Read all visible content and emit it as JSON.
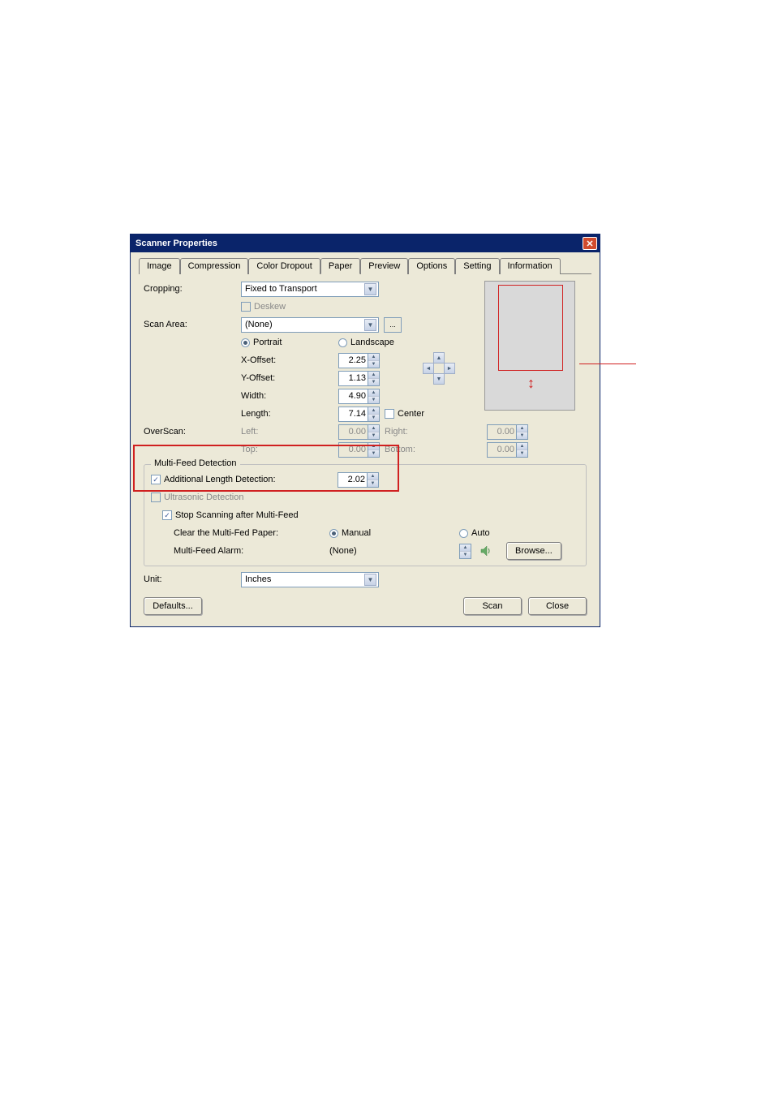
{
  "window": {
    "title": "Scanner Properties"
  },
  "tabs": {
    "image": "Image",
    "compression": "Compression",
    "color_dropout": "Color Dropout",
    "paper": "Paper",
    "preview": "Preview",
    "options": "Options",
    "setting": "Setting",
    "information": "Information"
  },
  "labels": {
    "cropping": "Cropping:",
    "deskew": "Deskew",
    "scan_area": "Scan Area:",
    "portrait": "Portrait",
    "landscape": "Landscape",
    "x_offset": "X-Offset:",
    "y_offset": "Y-Offset:",
    "width": "Width:",
    "length": "Length:",
    "center": "Center",
    "overscan": "OverScan:",
    "left": "Left:",
    "right": "Right:",
    "top": "Top:",
    "bottom": "Bottom:",
    "multi_feed_detection": "Multi-Feed Detection",
    "additional_length": "Additional Length Detection:",
    "ultrasonic": "Ultrasonic Detection",
    "stop_scanning": "Stop Scanning after Multi-Feed",
    "clear_multifed": "Clear the Multi-Fed Paper:",
    "manual": "Manual",
    "auto": "Auto",
    "multifeed_alarm": "Multi-Feed Alarm:",
    "unit": "Unit:"
  },
  "values": {
    "cropping": "Fixed to Transport",
    "scan_area": "(None)",
    "x_offset": "2.25",
    "y_offset": "1.13",
    "width": "4.90",
    "length": "7.14",
    "left": "0.00",
    "right": "0.00",
    "top": "0.00",
    "bottom": "0.00",
    "additional_length": "2.02",
    "alarm": "(None)",
    "unit": "Inches"
  },
  "buttons": {
    "browse": "Browse...",
    "defaults": "Defaults...",
    "scan": "Scan",
    "close": "Close",
    "ellipsis": "..."
  }
}
